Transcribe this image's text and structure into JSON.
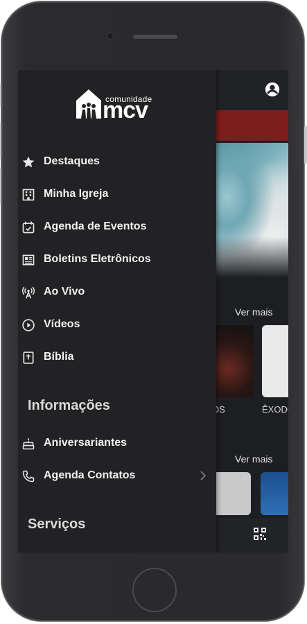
{
  "app": {
    "logo": {
      "small_text": "comunidade",
      "main_text": "mcv"
    }
  },
  "drawer": {
    "items": [
      {
        "label": "Destaques",
        "icon": "star-icon"
      },
      {
        "label": "Minha Igreja",
        "icon": "building-icon"
      },
      {
        "label": "Agenda de Eventos",
        "icon": "calendar-icon"
      },
      {
        "label": "Boletins Eletrônicos",
        "icon": "newspaper-icon"
      },
      {
        "label": "Ao Vivo",
        "icon": "broadcast-icon"
      },
      {
        "label": "Vídeos",
        "icon": "play-circle-icon"
      },
      {
        "label": "Bíblia",
        "icon": "bible-icon"
      }
    ],
    "sections": [
      {
        "title": "Informações",
        "items": [
          {
            "label": "Aniversariantes",
            "icon": "cake-icon"
          },
          {
            "label": "Agenda Contatos",
            "icon": "phone-icon"
          }
        ]
      },
      {
        "title": "Serviços",
        "items": []
      }
    ]
  },
  "background": {
    "see_more_1": "Ver mais",
    "see_more_2": "Ver mais",
    "thumb_label_1": "OS",
    "thumb_label_2": "ÊXODO"
  },
  "colors": {
    "drawer_bg": "#222224",
    "banner_red": "#7d1e1c"
  }
}
